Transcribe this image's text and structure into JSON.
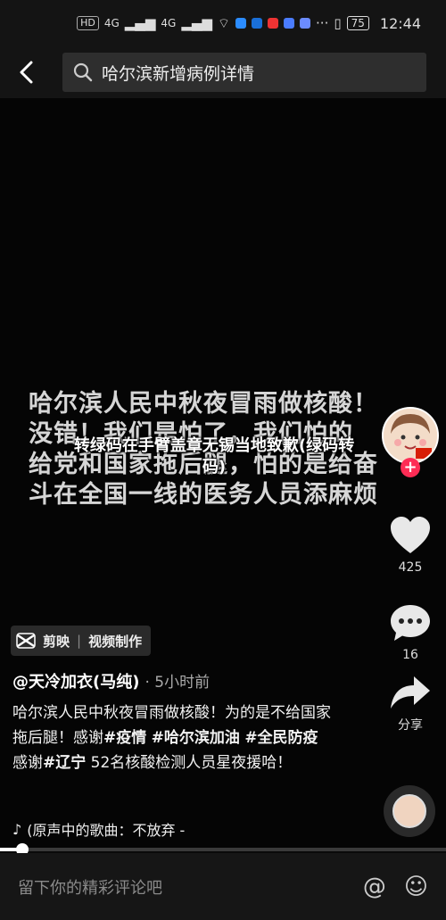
{
  "status": {
    "network": "HD",
    "signal1": "4G",
    "signal2": "4G",
    "battery": "75",
    "time": "12:44"
  },
  "search": {
    "query": "哈尔滨新增病例详情"
  },
  "video": {
    "handwriting_lines": [
      "哈尔滨人民中秋夜冒雨做核酸！",
      "没错！我们是怕了，我们怕的",
      "给党和国家拖后腿，怕的是给奋",
      "斗在全国一线的医务人员添麻烦"
    ],
    "overlay_title": "转绿码在手臂盖章无锡当地致歉(绿码转码)"
  },
  "actions": {
    "likes": "425",
    "comments": "16",
    "share_label": "分享"
  },
  "capcut": {
    "brand": "剪映",
    "separator": "|",
    "label": "视频制作"
  },
  "post": {
    "author": "@天冷加衣(马纯)",
    "time_ago": "· 5小时前",
    "desc_part1": "哈尔滨人民中秋夜冒雨做核酸！为的是不给国家拖后腿！感谢",
    "tag1": "#疫情",
    "tag2": "#哈尔滨加油",
    "tag3": "#全民防疫",
    "desc_part2": "感谢",
    "tag4": "#辽宁",
    "desc_part3": "52名核酸检测人员星夜援哈！",
    "music": "(原声中的歌曲：不放弃 -"
  },
  "progress": {
    "fraction": 0.05
  },
  "comment": {
    "placeholder": "留下你的精彩评论吧",
    "at_icon": "@",
    "emoji_icon": "☺"
  },
  "colors": {
    "accent": "#fe2c55"
  }
}
